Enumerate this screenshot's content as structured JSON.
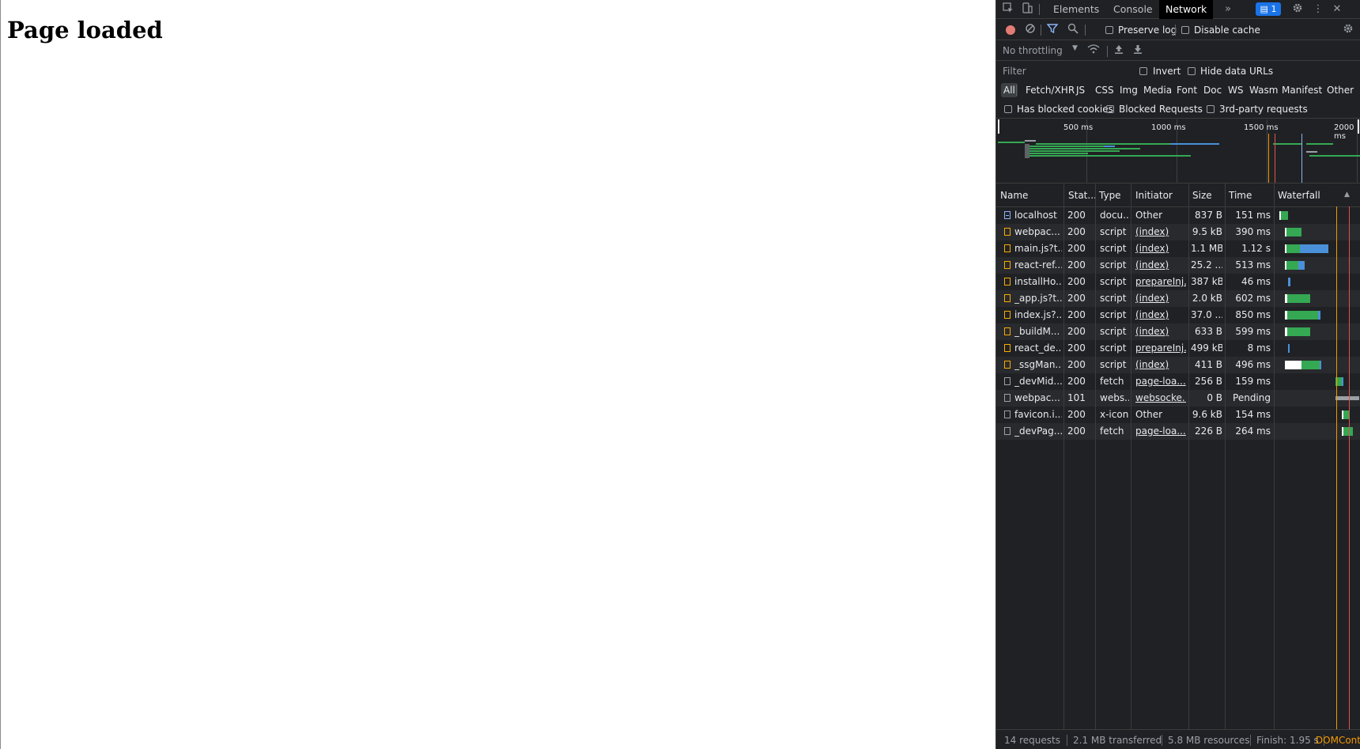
{
  "page": {
    "heading": "Page loaded"
  },
  "devtools": {
    "tabs": [
      "Elements",
      "Console",
      "Network"
    ],
    "active_tab": "Network",
    "more_tabs_icon": "chevron-double-right-icon",
    "issues_badge": "1",
    "toolbar": {
      "preserve_log": "Preserve log",
      "disable_cache": "Disable cache",
      "throttling": "No throttling"
    },
    "filter": {
      "placeholder": "Filter",
      "invert": "Invert",
      "hide_data_urls": "Hide data URLs"
    },
    "types": [
      "All",
      "Fetch/XHR",
      "JS",
      "CSS",
      "Img",
      "Media",
      "Font",
      "Doc",
      "WS",
      "Wasm",
      "Manifest",
      "Other"
    ],
    "blocked": {
      "has_blocked_cookies": "Has blocked cookies",
      "blocked_requests": "Blocked Requests",
      "third_party": "3rd-party requests"
    },
    "overview_ticks": [
      "500 ms",
      "1000 ms",
      "1500 ms",
      "2000 ms"
    ],
    "columns": [
      "Name",
      "Stat...",
      "Type",
      "Initiator",
      "Size",
      "Time",
      "Waterfall"
    ],
    "requests": [
      {
        "name": "localhost",
        "status": "200",
        "type": "docu...",
        "initiator": "Other",
        "initiator_link": false,
        "size": "837 B",
        "time": "151 ms",
        "icon": "document-icon"
      },
      {
        "name": "webpac...",
        "status": "200",
        "type": "script",
        "initiator": "(index)",
        "initiator_link": true,
        "size": "9.5 kB",
        "time": "390 ms",
        "icon": "script-icon"
      },
      {
        "name": "main.js?t...",
        "status": "200",
        "type": "script",
        "initiator": "(index)",
        "initiator_link": true,
        "size": "1.1 MB",
        "time": "1.12 s",
        "icon": "script-icon"
      },
      {
        "name": "react-ref...",
        "status": "200",
        "type": "script",
        "initiator": "(index)",
        "initiator_link": true,
        "size": "25.2 ...",
        "time": "513 ms",
        "icon": "script-icon"
      },
      {
        "name": "installHo...",
        "status": "200",
        "type": "script",
        "initiator": "prepareInj...",
        "initiator_link": true,
        "size": "387 kB",
        "time": "46 ms",
        "icon": "script-icon"
      },
      {
        "name": "_app.js?t...",
        "status": "200",
        "type": "script",
        "initiator": "(index)",
        "initiator_link": true,
        "size": "2.0 kB",
        "time": "602 ms",
        "icon": "script-icon"
      },
      {
        "name": "index.js?...",
        "status": "200",
        "type": "script",
        "initiator": "(index)",
        "initiator_link": true,
        "size": "37.0 ...",
        "time": "850 ms",
        "icon": "script-icon"
      },
      {
        "name": "_buildM...",
        "status": "200",
        "type": "script",
        "initiator": "(index)",
        "initiator_link": true,
        "size": "633 B",
        "time": "599 ms",
        "icon": "script-icon"
      },
      {
        "name": "react_de...",
        "status": "200",
        "type": "script",
        "initiator": "prepareInj...",
        "initiator_link": true,
        "size": "499 kB",
        "time": "8 ms",
        "icon": "script-icon"
      },
      {
        "name": "_ssgMan...",
        "status": "200",
        "type": "script",
        "initiator": "(index)",
        "initiator_link": true,
        "size": "411 B",
        "time": "496 ms",
        "icon": "script-icon"
      },
      {
        "name": "_devMid...",
        "status": "200",
        "type": "fetch",
        "initiator": "page-loa...",
        "initiator_link": true,
        "size": "256 B",
        "time": "159 ms",
        "icon": "blank-icon"
      },
      {
        "name": "webpac...",
        "status": "101",
        "type": "webs...",
        "initiator": "websocke...",
        "initiator_link": true,
        "size": "0 B",
        "time": "Pending",
        "icon": "blank-icon"
      },
      {
        "name": "favicon.i...",
        "status": "200",
        "type": "x-icon",
        "initiator": "Other",
        "initiator_link": false,
        "size": "9.6 kB",
        "time": "154 ms",
        "icon": "blank-icon"
      },
      {
        "name": "_devPag...",
        "status": "200",
        "type": "fetch",
        "initiator": "page-loa...",
        "initiator_link": true,
        "size": "226 B",
        "time": "264 ms",
        "icon": "blank-icon"
      }
    ],
    "status_bar": {
      "requests": "14 requests",
      "transferred": "2.1 MB transferred",
      "resources": "5.8 MB resources",
      "finish": "Finish: 1.95 s",
      "domcontent": "DOMCont"
    },
    "colors": {
      "waiting": "#ffffff",
      "download_green": "#34a853",
      "download_blue": "#4a90d9",
      "domcontent": "#f29900",
      "load_red": "#e05252"
    }
  }
}
